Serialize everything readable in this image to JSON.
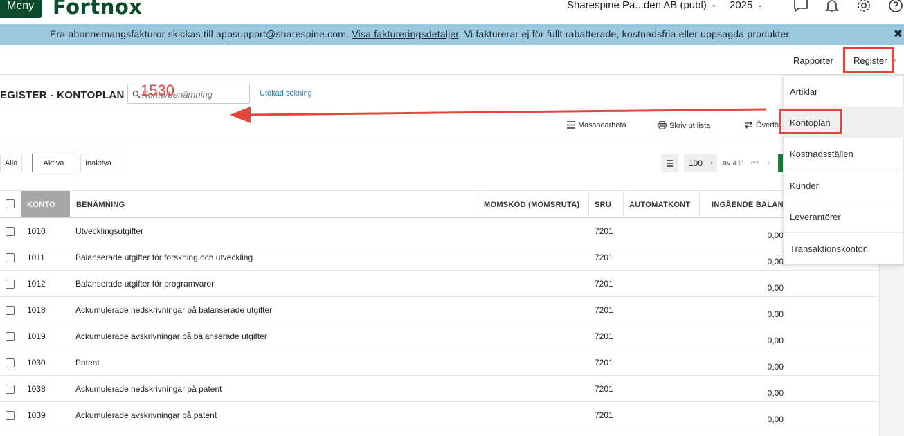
{
  "topbar": {
    "menu_label": "Meny",
    "logo_text": "Fortnox",
    "company": "Sharespine Pa...den AB (publ)",
    "year": "2025",
    "chevron": "⌄"
  },
  "banner": {
    "text_before": "Era abonnemangsfakturor skickas till appsupport@sharespine.com.",
    "link": "Visa faktureringsdetaljer",
    "text_after": ". Vi fakturerar ej för fullt rabatterade, kostnadsfria eller uppsagda produkter.",
    "close": "✖"
  },
  "nav": {
    "reports": "Rapporter",
    "register": "Register",
    "caret": "▾"
  },
  "page": {
    "title": "EGISTER - KONTOPLAN",
    "search_placeholder": "Konto/benämning",
    "search_overlay": "1530",
    "advanced_search": "Utökad sökning"
  },
  "toolbar": {
    "bulk_edit": "Massbearbeta",
    "print": "Skriv ut lista",
    "transfer": "Överför"
  },
  "filters": {
    "all": "Alla",
    "active": "Aktiva",
    "inactive": "Inaktiva"
  },
  "pager": {
    "page_size": "100",
    "caret": "▾",
    "of_total": "av 411",
    "first": "⏮",
    "prev": "‹"
  },
  "table": {
    "headers": {
      "konto": "KONTO",
      "benamning": "BENÄMNING",
      "momskod": "MOMSKOD (MOMSRUTA)",
      "sru": "SRU",
      "automatkont": "AUTOMATKONT",
      "ingaende": "INGÅENDE BALANS"
    },
    "rows": [
      {
        "konto": "1010",
        "benamning": "Utvecklingsutgifter",
        "sru": "7201",
        "balans": "0,00"
      },
      {
        "konto": "1011",
        "benamning": "Balanserade utgifter för forskning och utveckling",
        "sru": "7201",
        "balans": "0,00"
      },
      {
        "konto": "1012",
        "benamning": "Balanserade utgifter för programvaror",
        "sru": "7201",
        "balans": "0,00"
      },
      {
        "konto": "1018",
        "benamning": "Ackumulerade nedskrivningar på balanserade utgifter",
        "sru": "7201",
        "balans": "0,00"
      },
      {
        "konto": "1019",
        "benamning": "Ackumulerade avskrivningar på balanserade utgifter",
        "sru": "7201",
        "balans": "0,00"
      },
      {
        "konto": "1030",
        "benamning": "Patent",
        "sru": "7201",
        "balans": "0,00"
      },
      {
        "konto": "1038",
        "benamning": "Ackumulerade nedskrivningar på patent",
        "sru": "7201",
        "balans": "0,00"
      },
      {
        "konto": "1039",
        "benamning": "Ackumulerade avskrivningar på patent",
        "sru": "7201",
        "balans": "0,00"
      }
    ]
  },
  "dropdown": {
    "items": [
      {
        "label": "Artiklar"
      },
      {
        "label": "Kontoplan"
      },
      {
        "label": "Kostnadsställen"
      },
      {
        "label": "Kunder"
      },
      {
        "label": "Leverantörer"
      },
      {
        "label": "Transaktionskonton"
      }
    ]
  },
  "colors": {
    "brand_green": "#0c4a2c",
    "banner_blue": "#9cc8e0",
    "highlight_red": "#e0463a",
    "link_blue": "#1a7bbf"
  }
}
